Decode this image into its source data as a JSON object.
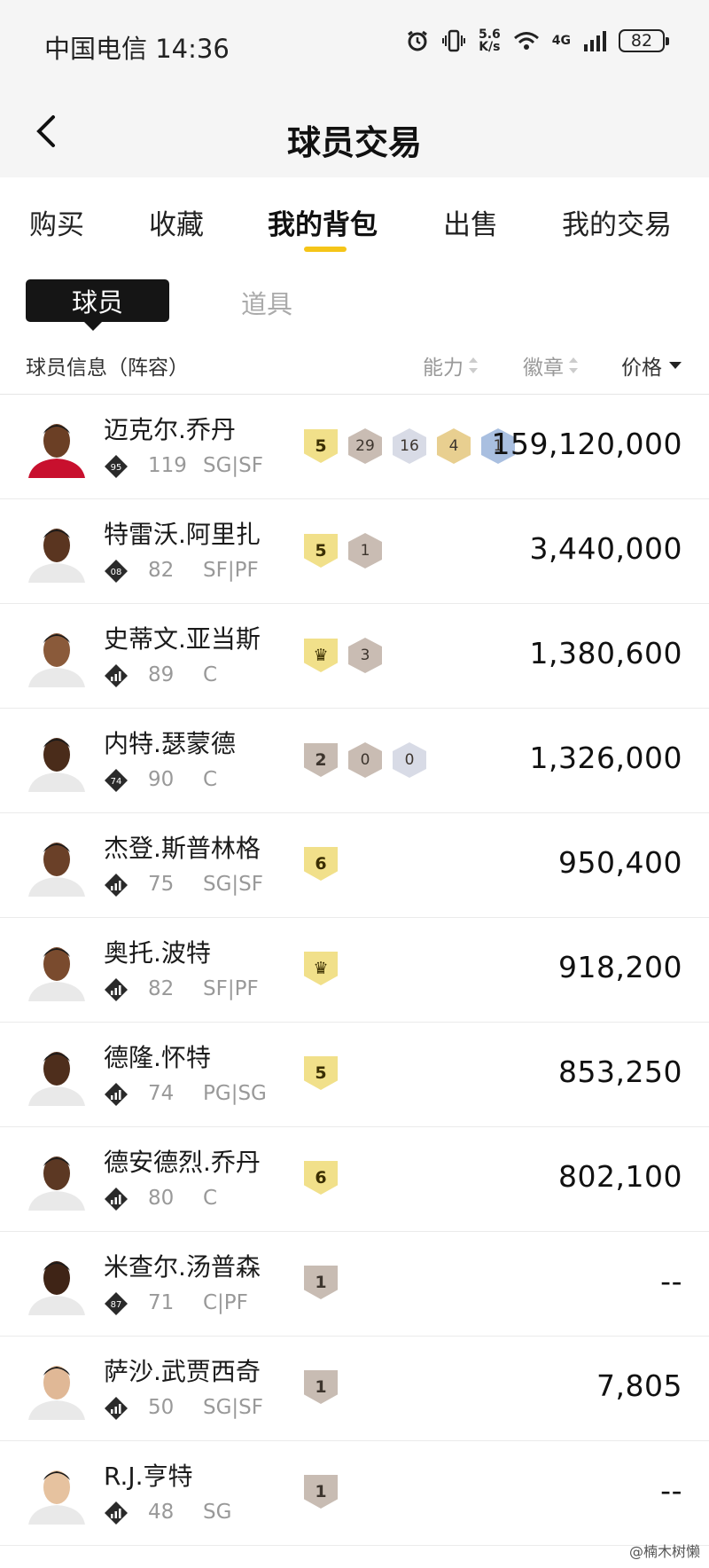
{
  "status": {
    "carrier_time": "中国电信 14:36",
    "speed_value": "5.6",
    "speed_unit": "K/s",
    "network": "4G",
    "battery": "82"
  },
  "header": {
    "title": "球员交易"
  },
  "tabs": [
    "购买",
    "收藏",
    "我的背包",
    "出售",
    "我的交易"
  ],
  "active_tab": "我的背包",
  "subtabs": {
    "players": "球员",
    "items": "道具"
  },
  "columns": {
    "info": "球员信息（阵容）",
    "ability": "能力",
    "badges": "徽章",
    "price": "价格"
  },
  "colors": {
    "accent": "#f5c518",
    "shield_gold": "#f1e08a",
    "shield_gray": "#c8bcb3",
    "hex_gray": "#c9bcb3",
    "hex_silver": "#d8dbe6",
    "hex_gold": "#e8cf90",
    "hex_blue": "#a9bfe0"
  },
  "players": [
    {
      "name": "迈克尔.乔丹",
      "rank": "95",
      "rank_type": "number",
      "ovr": "119",
      "pos": "SG|SF",
      "price": "159,120,000",
      "tags": [
        {
          "shape": "shield",
          "text": "5",
          "color": "shield_gold"
        },
        {
          "shape": "hex",
          "text": "29",
          "color": "hex_gray"
        },
        {
          "shape": "hex",
          "text": "16",
          "color": "hex_silver"
        },
        {
          "shape": "hex",
          "text": "4",
          "color": "hex_gold"
        },
        {
          "shape": "hex",
          "text": "1",
          "color": "hex_blue"
        }
      ]
    },
    {
      "name": "特雷沃.阿里扎",
      "rank": "08",
      "rank_type": "number",
      "ovr": "82",
      "pos": "SF|PF",
      "price": "3,440,000",
      "tags": [
        {
          "shape": "shield",
          "text": "5",
          "color": "shield_gold"
        },
        {
          "shape": "hex",
          "text": "1",
          "color": "hex_gray"
        }
      ]
    },
    {
      "name": "史蒂文.亚当斯",
      "rank": "",
      "rank_type": "bars",
      "ovr": "89",
      "pos": "C",
      "price": "1,380,600",
      "tags": [
        {
          "shape": "shield",
          "text": "♛",
          "color": "shield_gold"
        },
        {
          "shape": "hex",
          "text": "3",
          "color": "hex_gray"
        }
      ]
    },
    {
      "name": "内特.瑟蒙德",
      "rank": "74",
      "rank_type": "number",
      "ovr": "90",
      "pos": "C",
      "price": "1,326,000",
      "tags": [
        {
          "shape": "shield",
          "text": "2",
          "color": "shield_gray"
        },
        {
          "shape": "hex",
          "text": "0",
          "color": "hex_gray"
        },
        {
          "shape": "hex",
          "text": "0",
          "color": "hex_silver"
        }
      ]
    },
    {
      "name": "杰登.斯普林格",
      "rank": "",
      "rank_type": "bars",
      "ovr": "75",
      "pos": "SG|SF",
      "price": "950,400",
      "tags": [
        {
          "shape": "shield",
          "text": "6",
          "color": "shield_gold"
        }
      ]
    },
    {
      "name": "奥托.波特",
      "rank": "",
      "rank_type": "bars",
      "ovr": "82",
      "pos": "SF|PF",
      "price": "918,200",
      "tags": [
        {
          "shape": "shield",
          "text": "♛",
          "color": "shield_gold"
        }
      ]
    },
    {
      "name": "德隆.怀特",
      "rank": "",
      "rank_type": "bars",
      "ovr": "74",
      "pos": "PG|SG",
      "price": "853,250",
      "tags": [
        {
          "shape": "shield",
          "text": "5",
          "color": "shield_gold"
        }
      ]
    },
    {
      "name": "德安德烈.乔丹",
      "rank": "",
      "rank_type": "bars",
      "ovr": "80",
      "pos": "C",
      "price": "802,100",
      "tags": [
        {
          "shape": "shield",
          "text": "6",
          "color": "shield_gold"
        }
      ]
    },
    {
      "name": "米查尔.汤普森",
      "rank": "87",
      "rank_type": "number",
      "ovr": "71",
      "pos": "C|PF",
      "price": "--",
      "tags": [
        {
          "shape": "shield",
          "text": "1",
          "color": "shield_gray"
        }
      ]
    },
    {
      "name": "萨沙.武贾西奇",
      "rank": "",
      "rank_type": "bars",
      "ovr": "50",
      "pos": "SG|SF",
      "price": "7,805",
      "tags": [
        {
          "shape": "shield",
          "text": "1",
          "color": "shield_gray"
        }
      ]
    },
    {
      "name": "R.J.亨特",
      "rank": "",
      "rank_type": "bars",
      "ovr": "48",
      "pos": "SG",
      "price": "--",
      "tags": [
        {
          "shape": "shield",
          "text": "1",
          "color": "shield_gray"
        }
      ]
    }
  ],
  "watermark": "@楠木树懒"
}
